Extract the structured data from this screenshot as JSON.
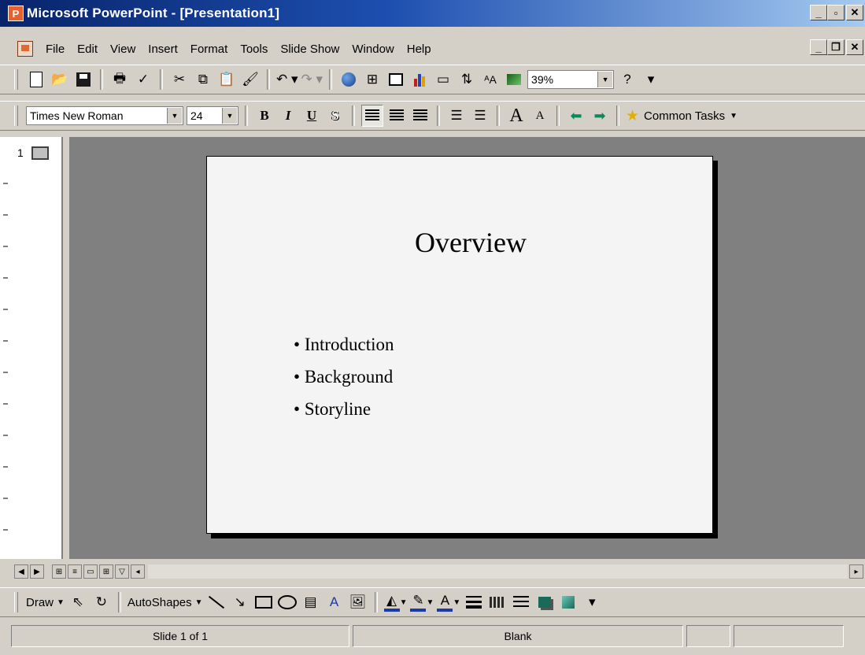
{
  "window": {
    "title": "Microsoft PowerPoint - [Presentation1]",
    "app_icon_letter": "P"
  },
  "menu": {
    "items": [
      "File",
      "Edit",
      "View",
      "Insert",
      "Format",
      "Tools",
      "Slide Show",
      "Window",
      "Help"
    ],
    "accelerators": [
      "F",
      "E",
      "V",
      "I",
      "o",
      "T",
      "d",
      "W",
      "H"
    ]
  },
  "standard_toolbar": {
    "zoom": "39%"
  },
  "formatting_toolbar": {
    "font": "Times New Roman",
    "font_size": "24",
    "bold": "B",
    "italic": "I",
    "underline": "U",
    "shadow": "S",
    "common_tasks": "Common Tasks"
  },
  "outline": {
    "slide_number": "1"
  },
  "slide": {
    "title": "Overview",
    "bullets": [
      "Introduction",
      "Background",
      "Storyline"
    ]
  },
  "drawing_toolbar": {
    "draw": "Draw",
    "autoshapes": "AutoShapes"
  },
  "status": {
    "slide_position": "Slide 1 of 1",
    "design": "Blank"
  },
  "colors": {
    "title_bar_start": "#08246b",
    "title_bar_end": "#a6caf0",
    "workspace": "#808080",
    "chrome": "#d4d0c8"
  }
}
